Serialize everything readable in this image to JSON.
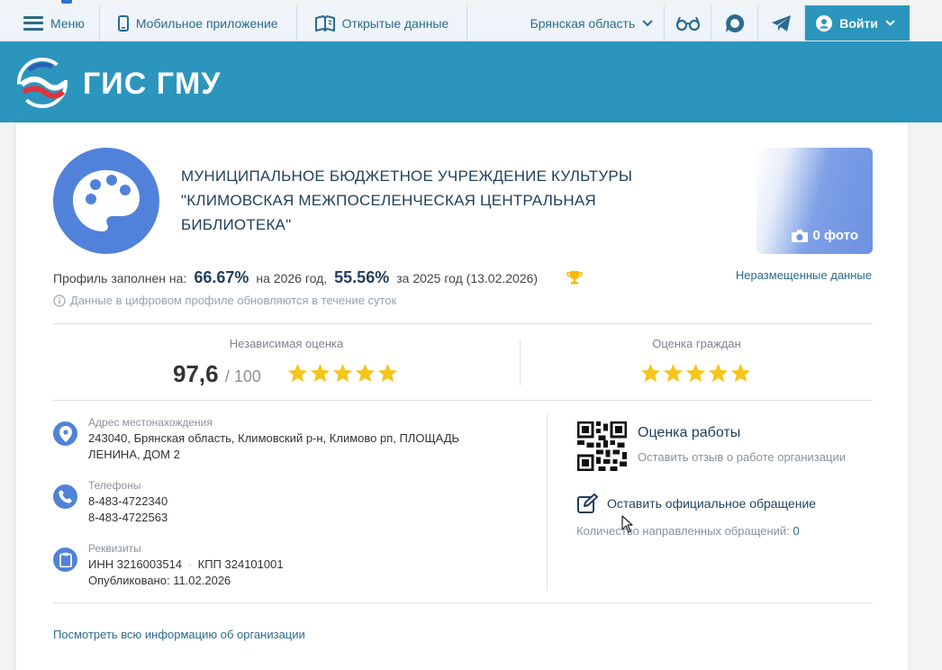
{
  "topnav": {
    "menu_label": "Меню",
    "mobile_label": "Мобильное приложение",
    "opendata_label": "Открытые данные",
    "region_label": "Брянская область",
    "login_label": "Войти"
  },
  "header": {
    "brand": "ГИС ГМУ"
  },
  "org": {
    "name": "МУНИЦИПАЛЬНОЕ БЮДЖЕТНОЕ УЧРЕЖДЕНИЕ КУЛЬТУРЫ \"КЛИМОВСКАЯ МЕЖПОСЕЛЕНЧЕСКАЯ ЦЕНТРАЛЬНАЯ БИБЛИОТЕКА\"",
    "photo_label": "0 фото"
  },
  "profile": {
    "filled_label": "Профиль заполнен на:",
    "pct_current": "66.67%",
    "current_year_label": "на 2026 год,",
    "pct_previous": "55.56%",
    "previous_year_label": "за 2025 год (13.02.2026)",
    "unplaced_link": "Неразмещенные данные",
    "note": "Данные в цифровом профиле обновляются в течение суток"
  },
  "ratings": {
    "independent_title": "Независимая оценка",
    "independent_score": "97,6",
    "independent_max": "/ 100",
    "independent_stars": 5,
    "citizens_title": "Оценка граждан",
    "citizens_stars": 5
  },
  "details": {
    "address_label": "Адрес местонахождения",
    "address_value": "243040, Брянская область, Климовский р-н, Климово рп, ПЛОЩАДЬ ЛЕНИНА, ДОМ 2",
    "phones_label": "Телефоны",
    "phone_1": "8-483-4722340",
    "phone_2": "8-483-4722563",
    "requisites_label": "Реквизиты",
    "inn": "ИНН 3216003514",
    "kpp": "КПП 324101001",
    "published": "Опубликовано: 11.02.2026"
  },
  "actions": {
    "work_title": "Оценка работы",
    "work_sub": "Оставить отзыв о работе организации",
    "appeal_label": "Оставить официальное обращение",
    "appeal_count_label": "Количество направленных обращений:",
    "appeal_count": "0"
  },
  "footer_link": "Посмотреть всю информацию об организации",
  "colors": {
    "accent": "#2c95bd",
    "icon_blue": "#5182d9",
    "star": "#f5c518"
  }
}
